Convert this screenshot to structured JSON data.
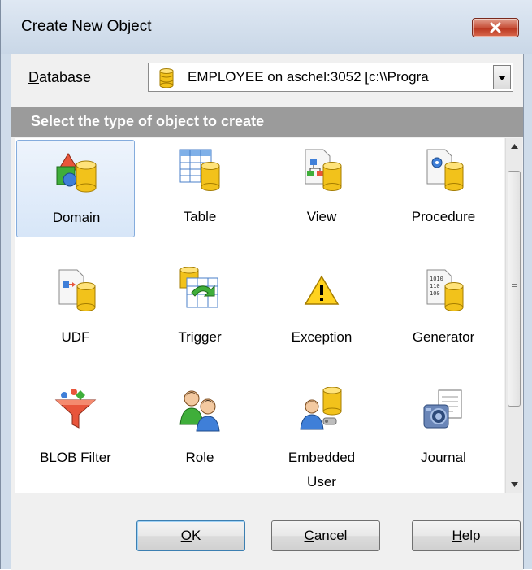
{
  "window": {
    "title": "Create New Object"
  },
  "database": {
    "label_underline": "D",
    "label_rest": "atabase",
    "value": "EMPLOYEE on aschel:3052 [c:\\\\Progra",
    "icon": "database-icon"
  },
  "header": {
    "text": "Select the type of object to create"
  },
  "objects": [
    {
      "label": "Domain",
      "icon": "domain-icon",
      "selected": true
    },
    {
      "label": "Table",
      "icon": "table-icon"
    },
    {
      "label": "View",
      "icon": "view-icon"
    },
    {
      "label": "Procedure",
      "icon": "procedure-icon"
    },
    {
      "label": "UDF",
      "icon": "udf-icon"
    },
    {
      "label": "Trigger",
      "icon": "trigger-icon"
    },
    {
      "label": "Exception",
      "icon": "exception-icon"
    },
    {
      "label": "Generator",
      "icon": "generator-icon"
    },
    {
      "label": "BLOB Filter",
      "icon": "blob-filter-icon"
    },
    {
      "label": "Role",
      "icon": "role-icon"
    },
    {
      "label": "Embedded User",
      "label_line1": "Embedded",
      "label_line2": "User",
      "icon": "embedded-user-icon"
    },
    {
      "label": "Journal",
      "icon": "journal-icon"
    }
  ],
  "buttons": {
    "ok_u": "O",
    "ok_rest": "K",
    "cancel_u": "C",
    "cancel_rest": "ancel",
    "help_u": "H",
    "help_rest": "elp"
  },
  "colors": {
    "selected_tile": "#d7e6f8",
    "header_band": "#9b9b9b",
    "close_button": "#c75039"
  }
}
